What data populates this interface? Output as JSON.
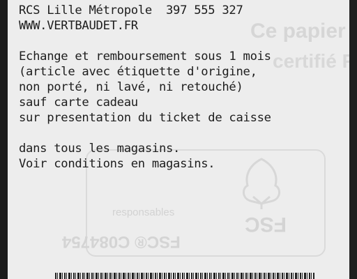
{
  "receipt": {
    "header_lines": [
      "RCS Lille Métropole  397 555 327",
      "WWW.VERTBAUDET.FR"
    ],
    "policy_lines": [
      "Echange et remboursement sous 1 mois",
      "(article avec étiquette d'origine,",
      "non porté, ni lavé, ni retouché)",
      "sauf carte cadeau",
      "sur presentation du ticket de caisse"
    ],
    "store_lines": [
      "dans tous les magasins.",
      "Voir conditions en magasins."
    ]
  },
  "ghost_print": {
    "line1": "Ce papier thermique est",
    "line2": "certifié FSC®",
    "fsc_caption": "responsables",
    "fsc_code": "FSC® C084754",
    "fsc_logo": "FSC"
  },
  "colors": {
    "paper": "#ededed",
    "ink": "#1d1d1d",
    "background": "#141414"
  }
}
